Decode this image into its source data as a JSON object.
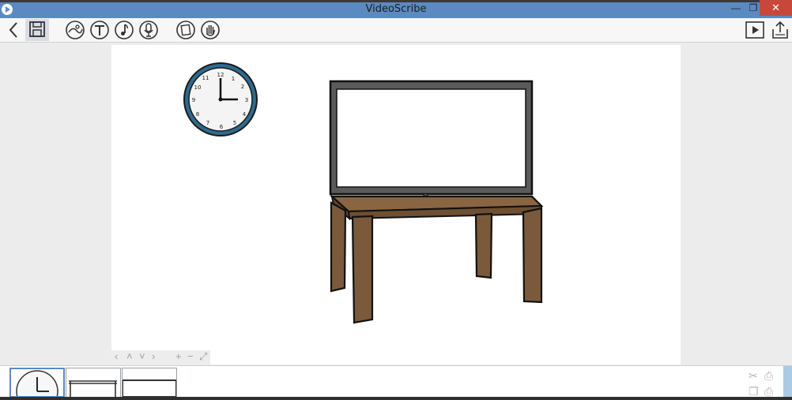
{
  "window": {
    "title": "VideoScribe",
    "minimize": "—",
    "maximize": "❐",
    "close": "✕"
  },
  "toolbar": {
    "items": [
      {
        "name": "back-icon",
        "tooltip": ""
      },
      {
        "name": "save-icon"
      },
      {
        "name": "add-image-icon"
      },
      {
        "name": "add-text-icon"
      },
      {
        "name": "music-icon"
      },
      {
        "name": "voiceover-icon"
      },
      {
        "name": "background-icon"
      },
      {
        "name": "hand-icon"
      },
      {
        "name": "play-icon"
      },
      {
        "name": "export-icon"
      }
    ]
  },
  "canvas": {
    "elements": [
      "clock",
      "tv",
      "table"
    ]
  },
  "canvas_nav": {
    "left": "‹",
    "up": "˄",
    "down": "˅",
    "right": "›",
    "zoom_in": "+",
    "zoom_out": "−",
    "fit": "⤢"
  },
  "timeline": {
    "thumbnails": [
      "clock",
      "table",
      "tv"
    ]
  },
  "colors": {
    "titlebar": "#5b8ac0",
    "close": "#c7483a",
    "table_wood": "#7a5a3a",
    "tv_frame": "#5a5a5a",
    "clock_ring": "#2d6a8f"
  }
}
